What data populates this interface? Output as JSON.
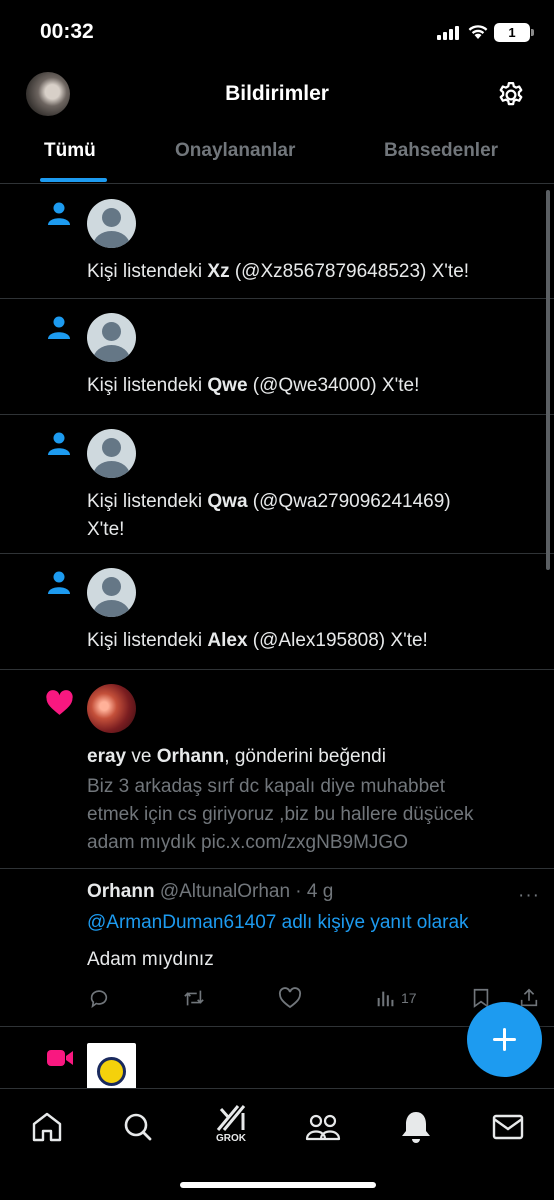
{
  "status_bar": {
    "time": "00:32",
    "battery": "1"
  },
  "header": {
    "title": "Bildirimler",
    "tabs": [
      {
        "label": "Tümü",
        "active": true
      },
      {
        "label": "Onaylananlar",
        "active": false
      },
      {
        "label": "Bahsedenler",
        "active": false
      }
    ]
  },
  "notifications": [
    {
      "prefix": "Kişi listendeki ",
      "name": "Xz",
      "handle": " (@Xz8567879648523) X'te!"
    },
    {
      "prefix": "Kişi listendeki ",
      "name": "Qwe",
      "handle": " (@Qwe34000) X'te!"
    },
    {
      "prefix": "Kişi listendeki ",
      "name": "Qwa",
      "handle": " (@Qwa279096241469)",
      "line2": "X'te!"
    },
    {
      "prefix": "Kişi listendeki ",
      "name": "Alex",
      "handle": " (@Alex195808) X'te!"
    }
  ],
  "like_notification": {
    "user1": "eray",
    "connector": " ve ",
    "user2": "Orhann",
    "action": ", gönderini beğendi",
    "post_line1": "Biz 3 arkadaş sırf dc kapalı diye muhabbet",
    "post_line2": "etmek için cs giriyoruz ,biz bu hallere düşücek",
    "post_line3": "adam mıydık pic.x.com/zxgNB9MJGO"
  },
  "reply": {
    "name": "Orhann",
    "meta": " @AltunalOrhan · 4 g",
    "more": "···",
    "reply_to_handle": "@ArmanDuman61407",
    "reply_to_suffix": " adlı kişiye yanıt olarak",
    "body": "Adam mıydınız",
    "views": "17"
  },
  "nav": {
    "grok_label": "GROK"
  },
  "colors": {
    "accent": "#1d9bf0",
    "like": "#f91880",
    "space": "#f91880",
    "background": "#000000"
  }
}
